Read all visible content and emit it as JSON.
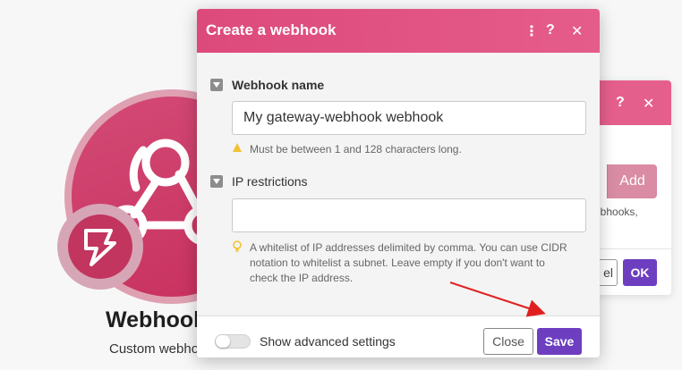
{
  "background_module": {
    "title": "Webhooks",
    "subtitle": "Custom webhook",
    "module_icon": "webhook-icon",
    "badge_icon": "lightning-bolt-icon"
  },
  "background_dialog": {
    "add_label": "Add",
    "hint_text": "ebhooks,",
    "cancel_label": "el",
    "ok_label": "OK"
  },
  "dialog": {
    "title": "Create a webhook",
    "header_icons": [
      "more-options-icon",
      "help-icon",
      "close-icon"
    ],
    "fields": {
      "webhook_name": {
        "label": "Webhook name",
        "value": "My gateway-webhook webhook",
        "help": "Must be between 1 and 128 characters long."
      },
      "ip_restrictions": {
        "label": "IP restrictions",
        "value": "",
        "help": "A whitelist of IP addresses delimited by comma. You can use CIDR notation to whitelist a subnet. Leave empty if you don't want to check the IP address."
      }
    },
    "footer": {
      "advanced_label": "Show advanced settings",
      "advanced_enabled": false,
      "close_label": "Close",
      "save_label": "Save"
    }
  },
  "colors": {
    "header_pink": "#e55c8a",
    "primary_purple": "#6d3fc0",
    "annotation_arrow": "#e02020"
  }
}
